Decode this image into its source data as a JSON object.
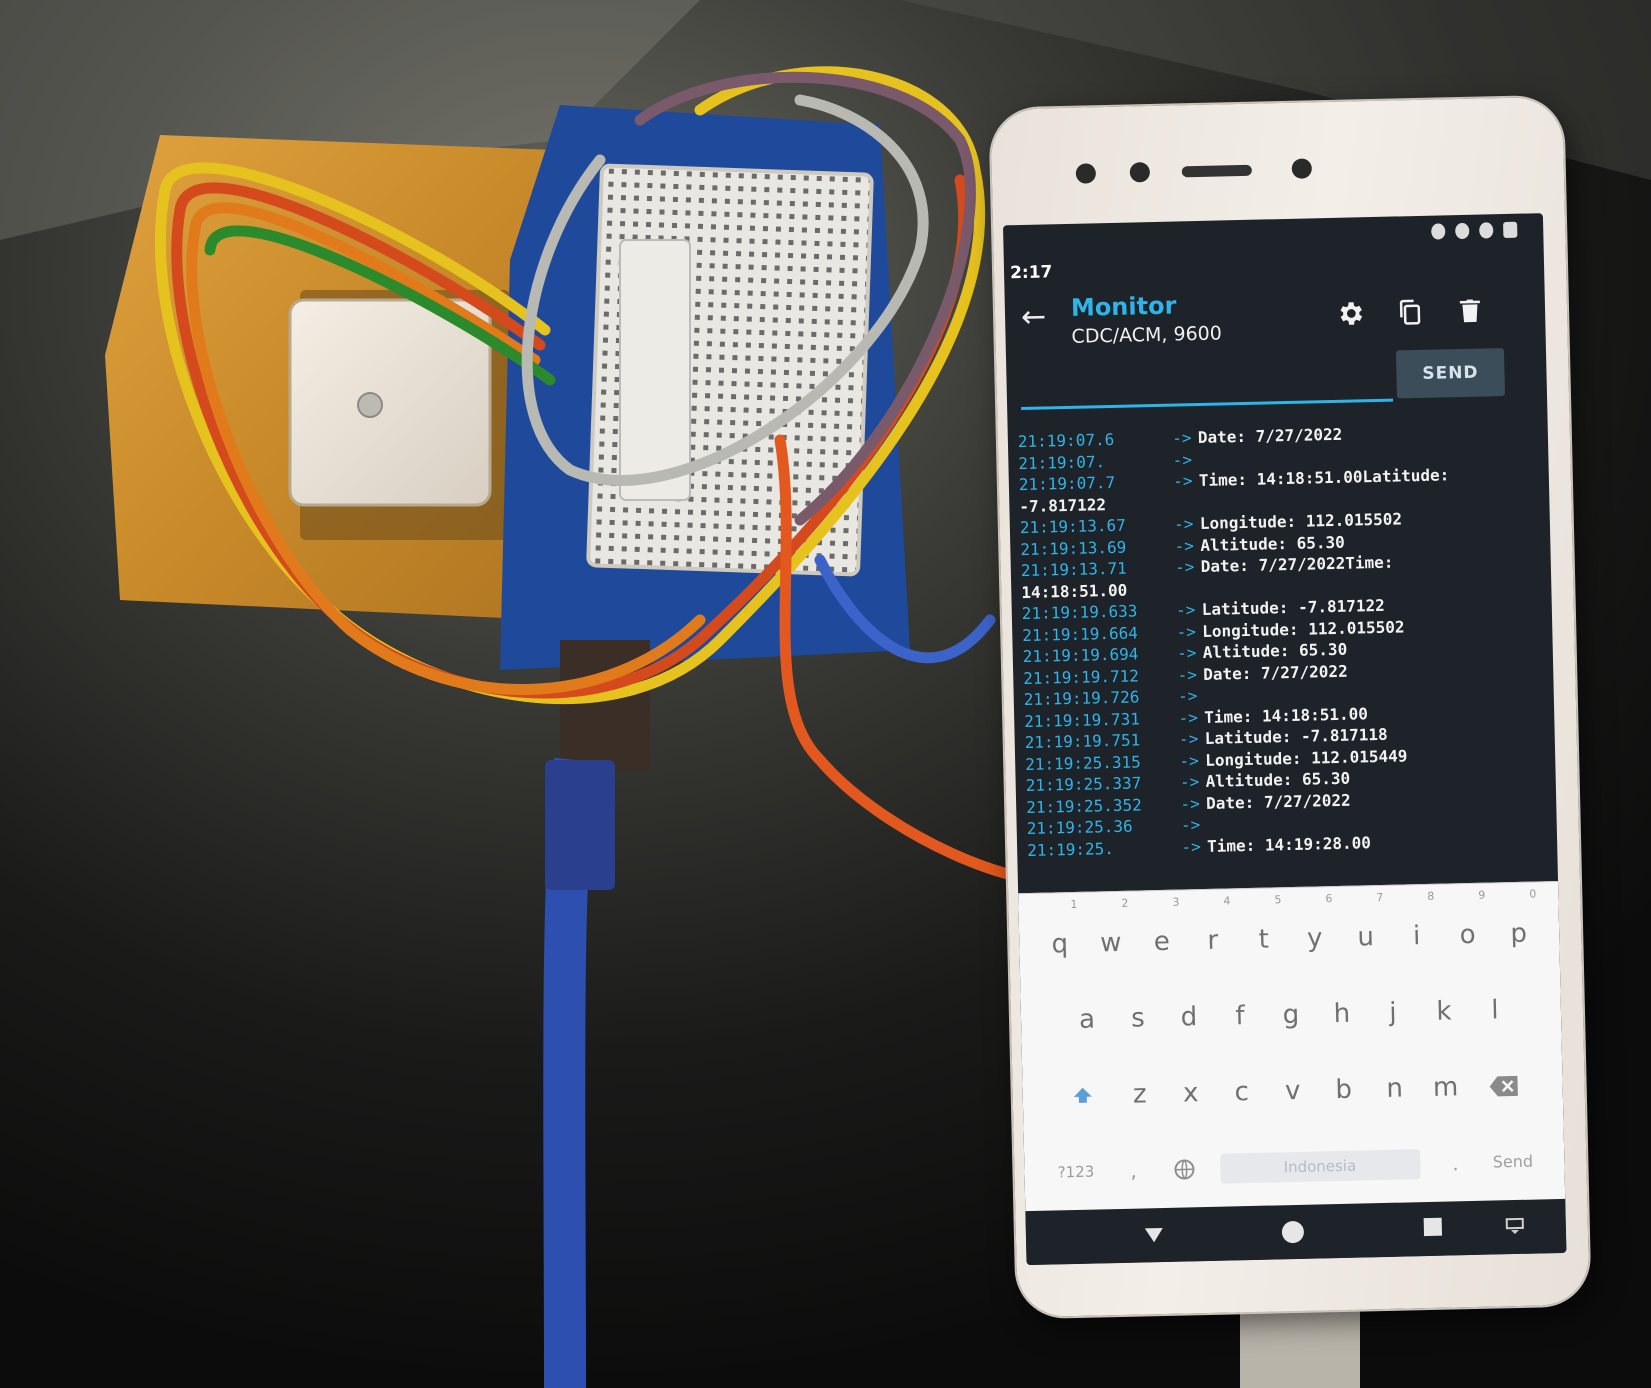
{
  "phone": {
    "status_bar": {
      "time": "2:17"
    },
    "app_bar": {
      "title": "Monitor",
      "subtitle": "CDC/ACM, 9600"
    },
    "send": {
      "input_value": "",
      "button_label": "SEND"
    },
    "log": [
      {
        "ts": "21:19:07.6",
        "arrow": "->",
        "text": "Date: 7/27/2022"
      },
      {
        "ts": "21:19:07.",
        "arrow": "->",
        "text": ""
      },
      {
        "ts": "21:19:07.7",
        "arrow": "->",
        "text": "Time: 14:18:51.00Latitude:"
      },
      {
        "ts": "",
        "arrow": "",
        "text": "-7.817122"
      },
      {
        "ts": "21:19:13.67",
        "arrow": "->",
        "text": "Longitude: 112.015502"
      },
      {
        "ts": "21:19:13.69",
        "arrow": "->",
        "text": "Altitude: 65.30"
      },
      {
        "ts": "21:19:13.71",
        "arrow": "->",
        "text": "Date: 7/27/2022Time:"
      },
      {
        "ts": "",
        "arrow": "",
        "text": "14:18:51.00"
      },
      {
        "ts": "21:19:19.633",
        "arrow": "->",
        "text": "Latitude: -7.817122"
      },
      {
        "ts": "21:19:19.664",
        "arrow": "->",
        "text": "Longitude: 112.015502"
      },
      {
        "ts": "21:19:19.694",
        "arrow": "->",
        "text": "Altitude: 65.30"
      },
      {
        "ts": "21:19:19.712",
        "arrow": "->",
        "text": "Date: 7/27/2022"
      },
      {
        "ts": "21:19:19.726",
        "arrow": "->",
        "text": ""
      },
      {
        "ts": "21:19:19.731",
        "arrow": "->",
        "text": "Time: 14:18:51.00"
      },
      {
        "ts": "21:19:19.751",
        "arrow": "->",
        "text": "Latitude: -7.817118"
      },
      {
        "ts": "21:19:25.315",
        "arrow": "->",
        "text": "Longitude: 112.015449"
      },
      {
        "ts": "21:19:25.337",
        "arrow": "->",
        "text": "Altitude: 65.30"
      },
      {
        "ts": "21:19:25.352",
        "arrow": "->",
        "text": "Date: 7/27/2022"
      },
      {
        "ts": "21:19:25.36",
        "arrow": "->",
        "text": ""
      },
      {
        "ts": "21:19:25.",
        "arrow": "->",
        "text": "Time: 14:19:28.00"
      }
    ],
    "keyboard": {
      "row1": [
        {
          "key": "q",
          "hint": "1"
        },
        {
          "key": "w",
          "hint": "2"
        },
        {
          "key": "e",
          "hint": "3"
        },
        {
          "key": "r",
          "hint": "4"
        },
        {
          "key": "t",
          "hint": "5"
        },
        {
          "key": "y",
          "hint": "6"
        },
        {
          "key": "u",
          "hint": "7"
        },
        {
          "key": "i",
          "hint": "8"
        },
        {
          "key": "o",
          "hint": "9"
        },
        {
          "key": "p",
          "hint": "0"
        }
      ],
      "row2": [
        "a",
        "s",
        "d",
        "f",
        "g",
        "h",
        "j",
        "k",
        "l"
      ],
      "row3": [
        "z",
        "x",
        "c",
        "v",
        "b",
        "n",
        "m"
      ],
      "symbols_label": "?123",
      "comma": ",",
      "space_label": "Indonesia",
      "period": ".",
      "action_label": "Send"
    }
  },
  "colors": {
    "accent": "#2fb3e8",
    "terminal_bg": "#1d2328",
    "terminal_text": "#f2f2f2",
    "send_button_bg": "#3c4d5a"
  },
  "icons": [
    "back-arrow-icon",
    "settings-icon",
    "copy-icon",
    "delete-icon",
    "shift-icon",
    "backspace-icon",
    "globe-icon",
    "nav-back-icon",
    "nav-home-icon",
    "nav-recents-icon",
    "keyboard-hide-icon"
  ]
}
